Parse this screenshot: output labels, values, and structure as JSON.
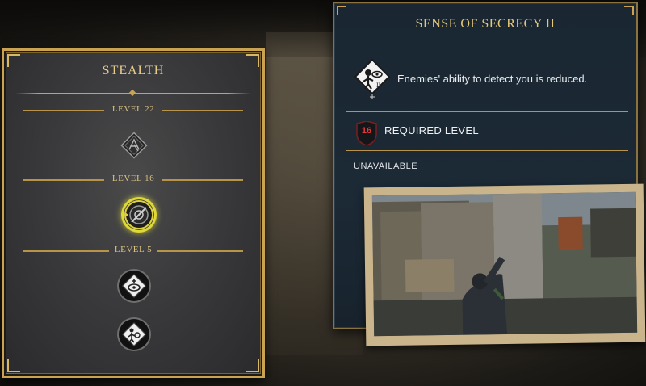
{
  "skill_tree": {
    "title": "STEALTH",
    "levels": [
      {
        "label": "LEVEL 22"
      },
      {
        "label": "LEVEL 16"
      },
      {
        "label": "LEVEL 5"
      }
    ],
    "skills": [
      {
        "icon": "diamond-glyph-icon",
        "state": "locked"
      },
      {
        "icon": "eye-disc-icon",
        "state": "selected"
      },
      {
        "icon": "eye-diamond-icon",
        "state": "unlocked"
      },
      {
        "icon": "figure-diamond-icon",
        "state": "unlocked"
      }
    ]
  },
  "detail": {
    "title": "SENSE OF SECRECY II",
    "description": "Enemies' ability to detect you is reduced.",
    "required_level": "16",
    "required_label": "REQUIRED LEVEL",
    "status": "UNAVAILABLE",
    "skill_icon": "sense-of-secrecy-icon"
  },
  "colors": {
    "gold": "#c9a352",
    "panel_blue": "#1a2733",
    "selected_glow": "#e8e23a",
    "required_red": "#e23a3a"
  }
}
